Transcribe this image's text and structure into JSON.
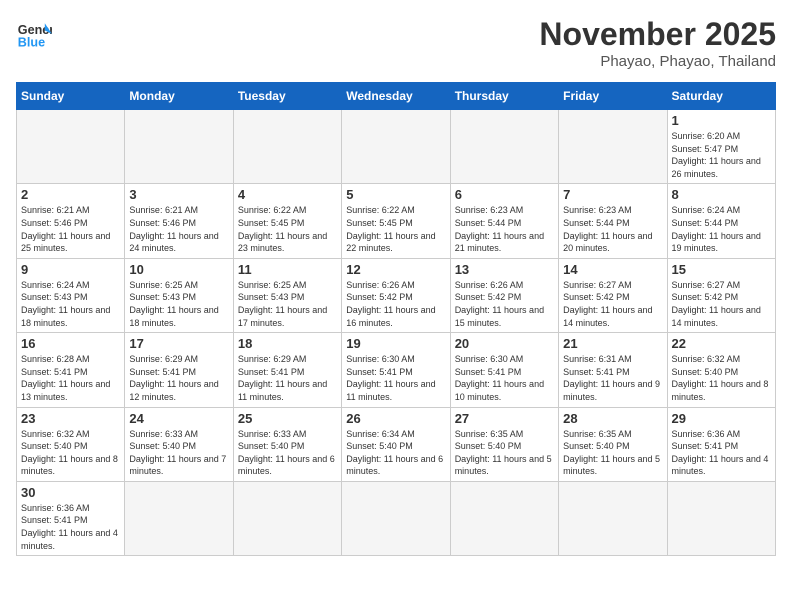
{
  "header": {
    "logo_line1": "General",
    "logo_line2": "Blue",
    "month_title": "November 2025",
    "location": "Phayao, Phayao, Thailand"
  },
  "weekdays": [
    "Sunday",
    "Monday",
    "Tuesday",
    "Wednesday",
    "Thursday",
    "Friday",
    "Saturday"
  ],
  "days": [
    {
      "num": "",
      "info": ""
    },
    {
      "num": "",
      "info": ""
    },
    {
      "num": "",
      "info": ""
    },
    {
      "num": "",
      "info": ""
    },
    {
      "num": "",
      "info": ""
    },
    {
      "num": "",
      "info": ""
    },
    {
      "num": "1",
      "sunrise": "6:20 AM",
      "sunset": "5:47 PM",
      "daylight": "11 hours and 26 minutes."
    },
    {
      "num": "2",
      "sunrise": "6:21 AM",
      "sunset": "5:46 PM",
      "daylight": "11 hours and 25 minutes."
    },
    {
      "num": "3",
      "sunrise": "6:21 AM",
      "sunset": "5:46 PM",
      "daylight": "11 hours and 24 minutes."
    },
    {
      "num": "4",
      "sunrise": "6:22 AM",
      "sunset": "5:45 PM",
      "daylight": "11 hours and 23 minutes."
    },
    {
      "num": "5",
      "sunrise": "6:22 AM",
      "sunset": "5:45 PM",
      "daylight": "11 hours and 22 minutes."
    },
    {
      "num": "6",
      "sunrise": "6:23 AM",
      "sunset": "5:44 PM",
      "daylight": "11 hours and 21 minutes."
    },
    {
      "num": "7",
      "sunrise": "6:23 AM",
      "sunset": "5:44 PM",
      "daylight": "11 hours and 20 minutes."
    },
    {
      "num": "8",
      "sunrise": "6:24 AM",
      "sunset": "5:44 PM",
      "daylight": "11 hours and 19 minutes."
    },
    {
      "num": "9",
      "sunrise": "6:24 AM",
      "sunset": "5:43 PM",
      "daylight": "11 hours and 18 minutes."
    },
    {
      "num": "10",
      "sunrise": "6:25 AM",
      "sunset": "5:43 PM",
      "daylight": "11 hours and 18 minutes."
    },
    {
      "num": "11",
      "sunrise": "6:25 AM",
      "sunset": "5:43 PM",
      "daylight": "11 hours and 17 minutes."
    },
    {
      "num": "12",
      "sunrise": "6:26 AM",
      "sunset": "5:42 PM",
      "daylight": "11 hours and 16 minutes."
    },
    {
      "num": "13",
      "sunrise": "6:26 AM",
      "sunset": "5:42 PM",
      "daylight": "11 hours and 15 minutes."
    },
    {
      "num": "14",
      "sunrise": "6:27 AM",
      "sunset": "5:42 PM",
      "daylight": "11 hours and 14 minutes."
    },
    {
      "num": "15",
      "sunrise": "6:27 AM",
      "sunset": "5:42 PM",
      "daylight": "11 hours and 14 minutes."
    },
    {
      "num": "16",
      "sunrise": "6:28 AM",
      "sunset": "5:41 PM",
      "daylight": "11 hours and 13 minutes."
    },
    {
      "num": "17",
      "sunrise": "6:29 AM",
      "sunset": "5:41 PM",
      "daylight": "11 hours and 12 minutes."
    },
    {
      "num": "18",
      "sunrise": "6:29 AM",
      "sunset": "5:41 PM",
      "daylight": "11 hours and 11 minutes."
    },
    {
      "num": "19",
      "sunrise": "6:30 AM",
      "sunset": "5:41 PM",
      "daylight": "11 hours and 11 minutes."
    },
    {
      "num": "20",
      "sunrise": "6:30 AM",
      "sunset": "5:41 PM",
      "daylight": "11 hours and 10 minutes."
    },
    {
      "num": "21",
      "sunrise": "6:31 AM",
      "sunset": "5:41 PM",
      "daylight": "11 hours and 9 minutes."
    },
    {
      "num": "22",
      "sunrise": "6:32 AM",
      "sunset": "5:40 PM",
      "daylight": "11 hours and 8 minutes."
    },
    {
      "num": "23",
      "sunrise": "6:32 AM",
      "sunset": "5:40 PM",
      "daylight": "11 hours and 8 minutes."
    },
    {
      "num": "24",
      "sunrise": "6:33 AM",
      "sunset": "5:40 PM",
      "daylight": "11 hours and 7 minutes."
    },
    {
      "num": "25",
      "sunrise": "6:33 AM",
      "sunset": "5:40 PM",
      "daylight": "11 hours and 6 minutes."
    },
    {
      "num": "26",
      "sunrise": "6:34 AM",
      "sunset": "5:40 PM",
      "daylight": "11 hours and 6 minutes."
    },
    {
      "num": "27",
      "sunrise": "6:35 AM",
      "sunset": "5:40 PM",
      "daylight": "11 hours and 5 minutes."
    },
    {
      "num": "28",
      "sunrise": "6:35 AM",
      "sunset": "5:40 PM",
      "daylight": "11 hours and 5 minutes."
    },
    {
      "num": "29",
      "sunrise": "6:36 AM",
      "sunset": "5:41 PM",
      "daylight": "11 hours and 4 minutes."
    },
    {
      "num": "30",
      "sunrise": "6:36 AM",
      "sunset": "5:41 PM",
      "daylight": "11 hours and 4 minutes."
    }
  ]
}
